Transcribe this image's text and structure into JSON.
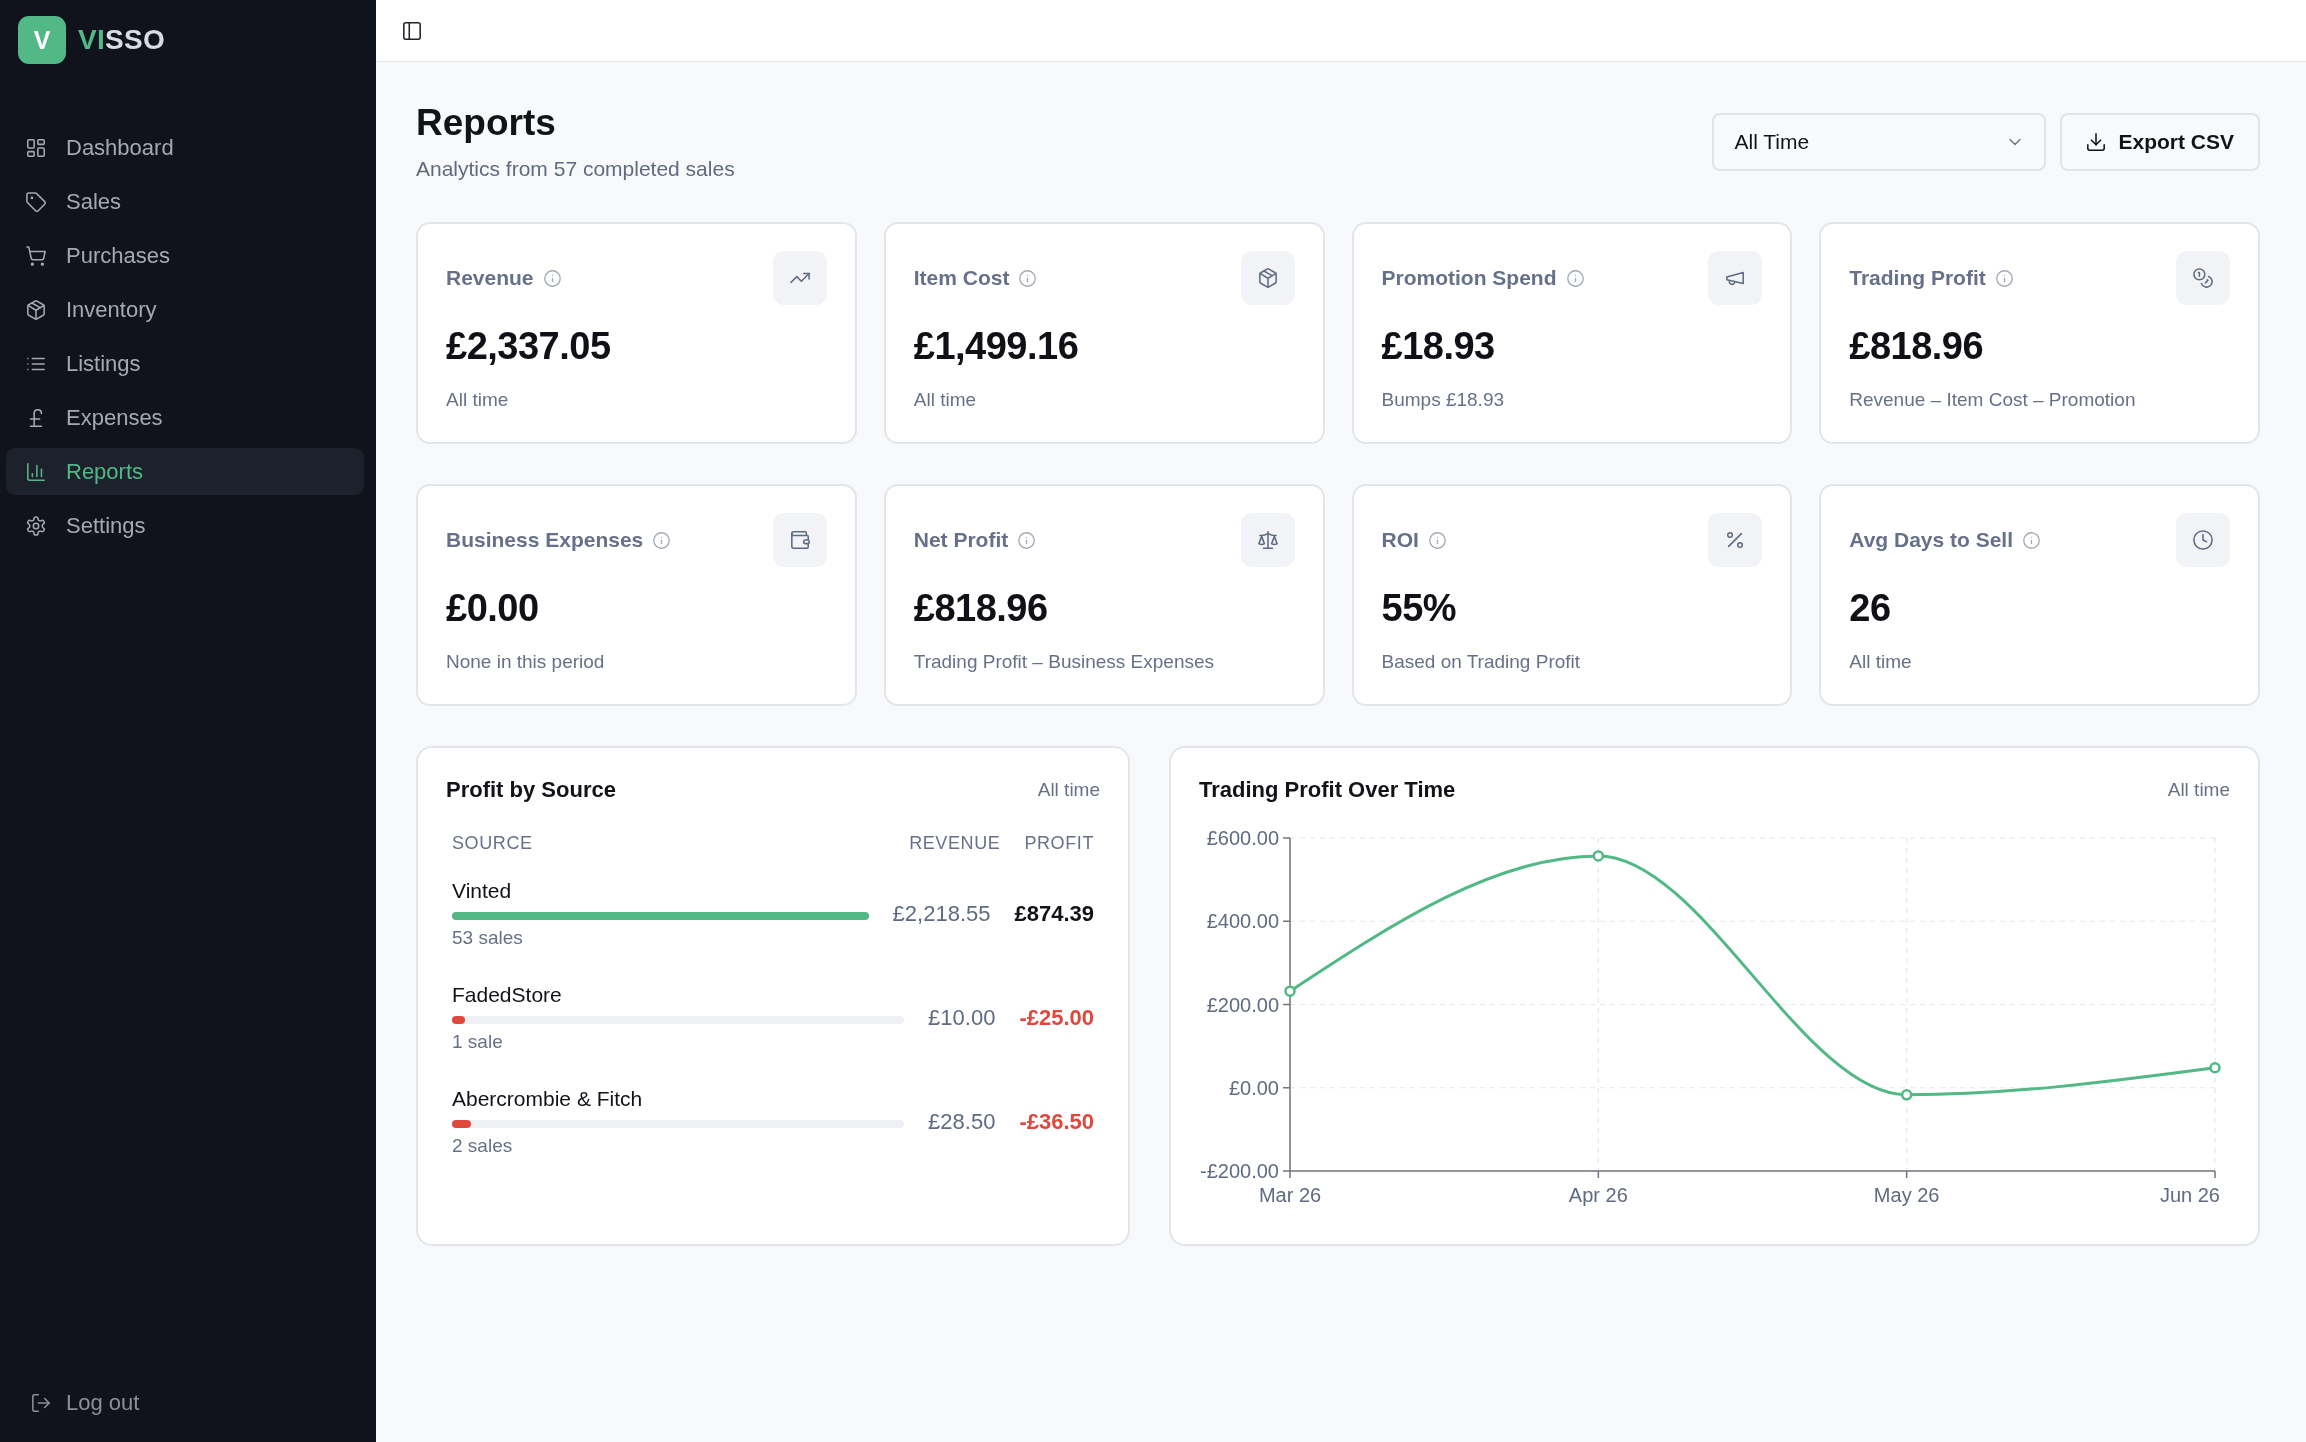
{
  "sidebar": {
    "brand": {
      "mark": "V",
      "name_accent": "VI",
      "name": "SSO"
    },
    "items": [
      {
        "label": "Dashboard",
        "selected": false
      },
      {
        "label": "Sales",
        "selected": false
      },
      {
        "label": "Purchases",
        "selected": false
      },
      {
        "label": "Inventory",
        "selected": false
      },
      {
        "label": "Listings",
        "selected": false
      },
      {
        "label": "Expenses",
        "selected": false
      },
      {
        "label": "Reports",
        "selected": true
      },
      {
        "label": "Settings",
        "selected": false
      }
    ],
    "logout": "Log out"
  },
  "header": {
    "title": "Reports",
    "subtitle": "Analytics from 57 completed sales",
    "period_select": {
      "value": "All Time"
    },
    "export_button": "Export CSV"
  },
  "stats": [
    {
      "label": "Revenue",
      "value": "£2,337.05",
      "note": "All time"
    },
    {
      "label": "Item Cost",
      "value": "£1,499.16",
      "note": "All time"
    },
    {
      "label": "Promotion Spend",
      "value": "£18.93",
      "note": "Bumps £18.93"
    },
    {
      "label": "Trading Profit",
      "value": "£818.96",
      "note": "Revenue – Item Cost – Promotion"
    },
    {
      "label": "Business Expenses",
      "value": "£0.00",
      "note": "None in this period"
    },
    {
      "label": "Net Profit",
      "value": "£818.96",
      "note": "Trading Profit – Business Expenses"
    },
    {
      "label": "ROI",
      "value": "55%",
      "note": "Based on Trading Profit"
    },
    {
      "label": "Avg Days to Sell",
      "value": "26",
      "note": "All time"
    }
  ],
  "profit_by_source": {
    "title": "Profit by Source",
    "period": "All time",
    "columns": [
      "SOURCE",
      "REVENUE",
      "PROFIT"
    ],
    "rows": [
      {
        "source": "Vinted",
        "sales": "53 sales",
        "revenue": "£2,218.55",
        "profit": "£874.39",
        "negative": false,
        "level": 1
      },
      {
        "source": "FadedStore",
        "sales": "1 sale",
        "revenue": "£10.00",
        "profit": "-£25.00",
        "negative": true,
        "level": 0.029
      },
      {
        "source": "Abercrombie & Fitch",
        "sales": "2 sales",
        "revenue": "£28.50",
        "profit": "-£36.50",
        "negative": true,
        "level": 0.042
      }
    ]
  },
  "profit_chart": {
    "period": "All time",
    "chart_data": {
      "type": "line",
      "title": "Trading Profit Over Time",
      "categories": [
        "Mar 26",
        "Apr 26",
        "May 26",
        "Jun 26"
      ],
      "series": [
        {
          "color": "#52b886",
          "marker": true,
          "values": [
            232,
            557,
            -17,
            48
          ]
        }
      ],
      "ylim": [
        -200,
        600
      ],
      "yticks": [
        {
          "value": -200,
          "label": "-£200.00"
        },
        {
          "value": 0,
          "label": "£0.00"
        },
        {
          "value": 200,
          "label": "£200.00"
        },
        {
          "value": 400,
          "label": "£400.00"
        },
        {
          "value": 600,
          "label": "£600.00"
        }
      ],
      "grid": true
    }
  }
}
